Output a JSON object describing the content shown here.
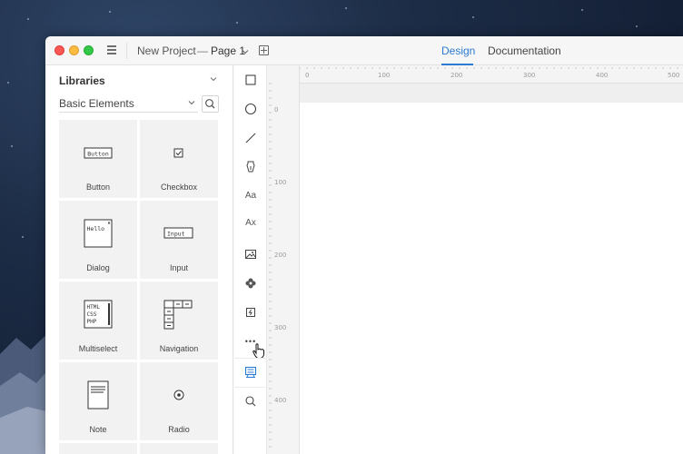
{
  "window": {
    "project_name": "New Project",
    "separator": "—",
    "page_name": "Page 1",
    "tabs": [
      {
        "label": "Design",
        "active": true
      },
      {
        "label": "Documentation",
        "active": false
      }
    ],
    "accent_color": "#2a7ad1"
  },
  "sidebar": {
    "title": "Libraries",
    "library_select": "Basic Elements",
    "elements": [
      {
        "label": "Button",
        "preview": "Button"
      },
      {
        "label": "Checkbox",
        "preview": ""
      },
      {
        "label": "Dialog",
        "preview": "Hello"
      },
      {
        "label": "Input",
        "preview": "Input"
      },
      {
        "label": "Multiselect",
        "preview_lines": [
          "HTML",
          "CSS",
          "PHP"
        ]
      },
      {
        "label": "Navigation",
        "preview": ""
      },
      {
        "label": "Note",
        "preview": ""
      },
      {
        "label": "Radio",
        "preview": ""
      }
    ]
  },
  "toolbar": {
    "tools": [
      {
        "name": "rectangle-tool",
        "text": ""
      },
      {
        "name": "ellipse-tool",
        "text": ""
      },
      {
        "name": "line-tool",
        "text": ""
      },
      {
        "name": "pen-tool",
        "text": ""
      },
      {
        "name": "text-tool",
        "text": "Aa"
      },
      {
        "name": "text-style-tool",
        "text": "Ax"
      },
      {
        "name": "image-tool",
        "text": ""
      },
      {
        "name": "icon-tool",
        "text": ""
      },
      {
        "name": "flash-tool",
        "text": ""
      },
      {
        "name": "more-tool",
        "text": "•••"
      },
      {
        "name": "components-tool",
        "text": ""
      },
      {
        "name": "zoom-tool",
        "text": ""
      }
    ]
  },
  "rulers": {
    "horizontal_labels": [
      "0",
      "100",
      "200",
      "300",
      "400",
      "500"
    ],
    "vertical_labels": [
      "0",
      "100",
      "200",
      "300",
      "400"
    ]
  }
}
